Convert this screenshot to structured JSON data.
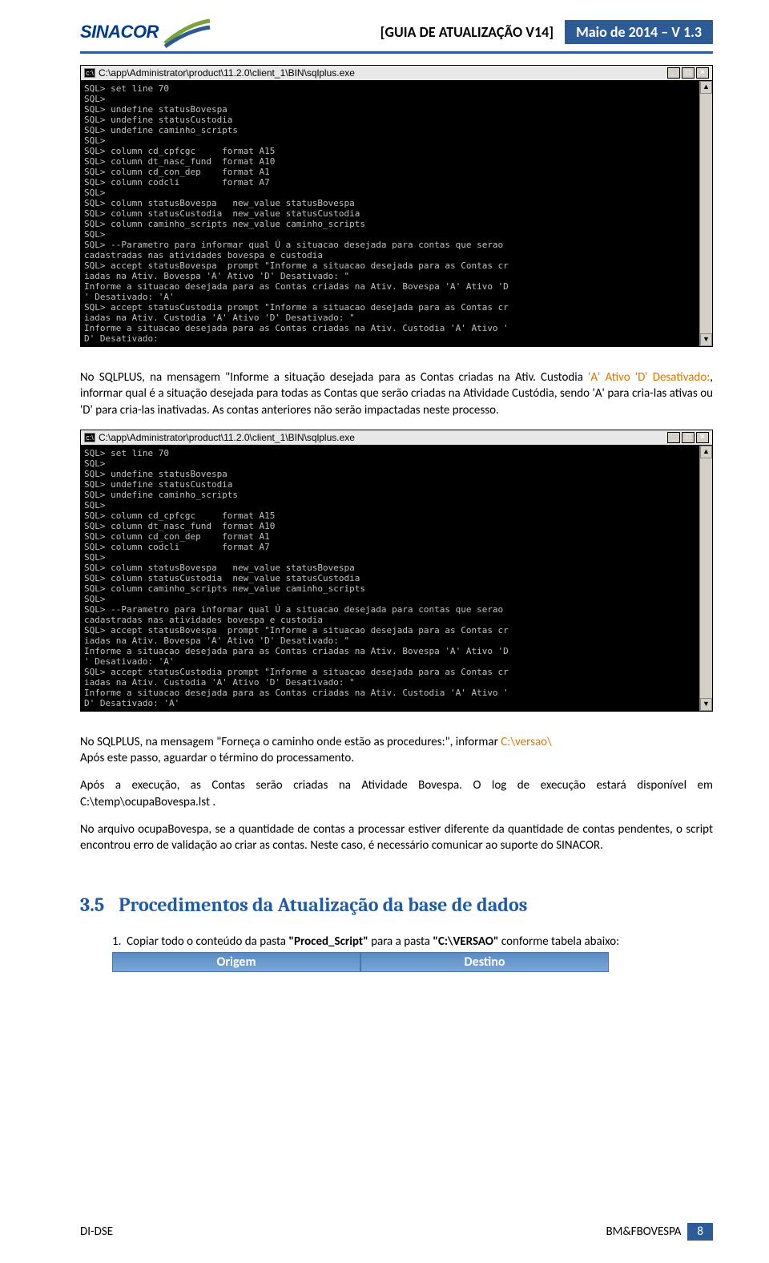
{
  "header": {
    "logo_text": "SINACOR",
    "title_bracketed": "GUIA DE ATUALIZAÇÃO V14",
    "title_date": "Maio de 2014 – V 1.3"
  },
  "terminal1": {
    "title": "C:\\app\\Administrator\\product\\11.2.0\\client_1\\BIN\\sqlplus.exe",
    "content": "SQL> set line 70\nSQL>\nSQL> undefine statusBovespa\nSQL> undefine statusCustodia\nSQL> undefine caminho_scripts\nSQL>\nSQL> column cd_cpfcgc     format A15\nSQL> column dt_nasc_fund  format A10\nSQL> column cd_con_dep    format A1\nSQL> column codcli        format A7\nSQL>\nSQL> column statusBovespa   new_value statusBovespa\nSQL> column statusCustodia  new_value statusCustodia\nSQL> column caminho_scripts new_value caminho_scripts\nSQL>\nSQL> --Parametro para informar qual Ú a situacao desejada para contas que serao\ncadastradas nas atividades bovespa e custodia\nSQL> accept statusBovespa  prompt \"Informe a situacao desejada para as Contas cr\niadas na Ativ. Bovespa 'A' Ativo 'D' Desativado: \"\nInforme a situacao desejada para as Contas criadas na Ativ. Bovespa 'A' Ativo 'D\n' Desativado: 'A'\nSQL> accept statusCustodia prompt \"Informe a situacao desejada para as Contas cr\niadas na Ativ. Custodia 'A' Ativo 'D' Desativado: \"\nInforme a situacao desejada para as Contas criadas na Ativ. Custodia 'A' Ativo '\nD' Desativado:"
  },
  "para1_a": "No SQLPLUS, na mensagem \"Informe a  situação desejada para as Contas criadas na Ativ. Custodia ",
  "para1_b": "'A' Ativo 'D' Desativado:",
  "para1_c": ", informar qual é a situação desejada para todas as Contas que serão criadas na Atividade Custódia, sendo 'A' para cria-las ativas ou 'D' para cria-las inativadas. As contas anteriores não serão impactadas neste processo.",
  "terminal2": {
    "title": "C:\\app\\Administrator\\product\\11.2.0\\client_1\\BIN\\sqlplus.exe",
    "content": "SQL> set line 70\nSQL>\nSQL> undefine statusBovespa\nSQL> undefine statusCustodia\nSQL> undefine caminho_scripts\nSQL>\nSQL> column cd_cpfcgc     format A15\nSQL> column dt_nasc_fund  format A10\nSQL> column cd_con_dep    format A1\nSQL> column codcli        format A7\nSQL>\nSQL> column statusBovespa   new_value statusBovespa\nSQL> column statusCustodia  new_value statusCustodia\nSQL> column caminho_scripts new_value caminho_scripts\nSQL>\nSQL> --Parametro para informar qual Ú a situacao desejada para contas que serao\ncadastradas nas atividades bovespa e custodia\nSQL> accept statusBovespa  prompt \"Informe a situacao desejada para as Contas cr\niadas na Ativ. Bovespa 'A' Ativo 'D' Desativado: \"\nInforme a situacao desejada para as Contas criadas na Ativ. Bovespa 'A' Ativo 'D\n' Desativado: 'A'\nSQL> accept statusCustodia prompt \"Informe a situacao desejada para as Contas cr\niadas na Ativ. Custodia 'A' Ativo 'D' Desativado: \"\nInforme a situacao desejada para as Contas criadas na Ativ. Custodia 'A' Ativo '\nD' Desativado: 'A'"
  },
  "para2_a": "No SQLPLUS, na mensagem \"Forneça o caminho onde estão as procedures:\", informar ",
  "para2_b": "C:\\versao\\",
  "para2_c": "Após este passo, aguardar o término do processamento.",
  "para3": "Após a execução, as Contas serão criadas na Atividade Bovespa. O log de execução estará disponível em C:\\temp\\ocupaBovespa.lst .",
  "para4": "No arquivo ocupaBovespa, se a quantidade de contas a processar estiver diferente da quantidade de contas pendentes, o script encontrou erro de validação ao criar as contas. Neste caso, é necessário comunicar ao suporte do SINACOR.",
  "section": {
    "number": "3.5",
    "title": "Procedimentos da Atualização da base de dados"
  },
  "item1_a": "Copiar todo o conteúdo da pasta ",
  "item1_b": "\"Proced_Script\"",
  "item1_c": " para a pasta ",
  "item1_d": "\"C:\\VERSAO\"",
  "item1_e": " conforme tabela abaixo:",
  "table": {
    "h1": "Origem",
    "h2": "Destino"
  },
  "footer": {
    "left": "DI-DSE",
    "right": "BM&FBOVESPA",
    "page": "8"
  }
}
